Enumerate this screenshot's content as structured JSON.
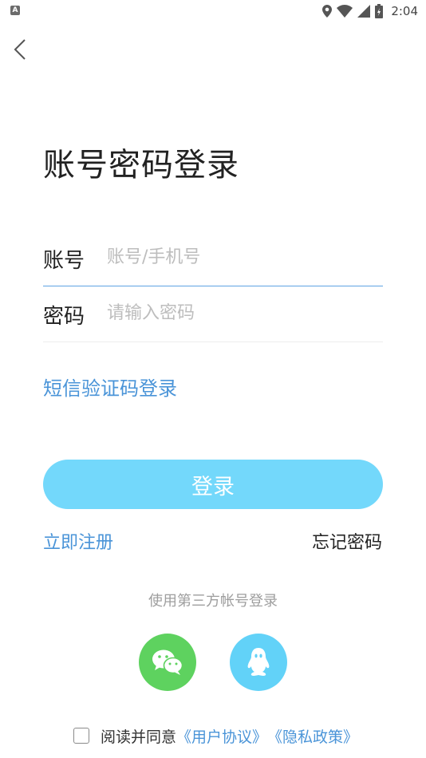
{
  "status_bar": {
    "notification_badge": "A",
    "time": "2:04",
    "icons": [
      "location-icon",
      "wifi-icon",
      "signal-icon",
      "battery-icon"
    ]
  },
  "header": {
    "back_icon": "chevron-left-icon"
  },
  "page": {
    "title": "账号密码登录"
  },
  "form": {
    "account": {
      "label": "账号",
      "placeholder": "账号/手机号",
      "value": ""
    },
    "password": {
      "label": "密码",
      "placeholder": "请输入密码",
      "value": ""
    }
  },
  "links": {
    "sms_login": "短信验证码登录",
    "register": "立即注册",
    "forgot_password": "忘记密码"
  },
  "login_button": "登录",
  "third_party": {
    "label": "使用第三方帐号登录",
    "providers": [
      {
        "name": "wechat",
        "icon": "wechat-icon",
        "color": "#5ed25f"
      },
      {
        "name": "qq",
        "icon": "qq-icon",
        "color": "#62d2f8"
      }
    ]
  },
  "agreement": {
    "text": "阅读并同意",
    "user_agreement": "《用户协议》",
    "privacy_policy": "《隐私政策》",
    "checked": false
  },
  "colors": {
    "accent": "#4a94d8",
    "button": "#73d8fb",
    "wechat": "#5ed25f",
    "qq": "#62d2f8"
  }
}
